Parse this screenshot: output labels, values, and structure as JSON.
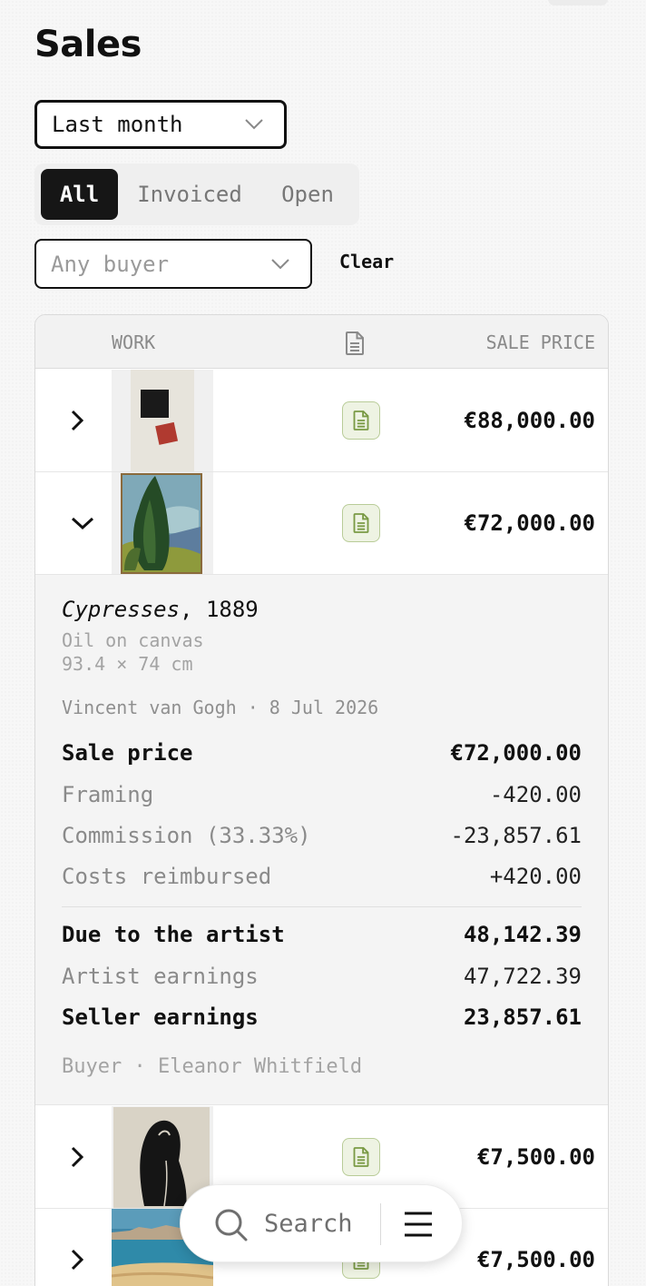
{
  "page": {
    "title": "Sales"
  },
  "filters": {
    "period": {
      "value": "Last month"
    },
    "segments": [
      {
        "label": "All",
        "selected": true
      },
      {
        "label": "Invoiced",
        "selected": false
      },
      {
        "label": "Open",
        "selected": false
      }
    ],
    "buyer": {
      "placeholder": "Any buyer"
    },
    "clear_label": "Clear"
  },
  "table": {
    "columns": {
      "work": "WORK",
      "document": "document-icon",
      "price": "SALE PRICE"
    },
    "rows": [
      {
        "expanded": false,
        "artwork_icon": "abstract-squares-thumbnail",
        "price": "€88,000.00"
      },
      {
        "expanded": true,
        "artwork_icon": "cypresses-painting-thumbnail",
        "price": "€72,000.00"
      },
      {
        "expanded": false,
        "artwork_icon": "kiss-woodcut-thumbnail",
        "price": "€7,500.00"
      },
      {
        "expanded": false,
        "artwork_icon": "seaside-painting-thumbnail",
        "price": "€7,500.00"
      }
    ],
    "detail": {
      "title_italic": "Cypresses",
      "title_rest": ", 1889",
      "medium": "Oil on canvas",
      "dimensions": "93.4 × 74 cm",
      "meta": "Vincent van Gogh · 8 Jul 2026",
      "lines": [
        {
          "label": "Sale price",
          "value": "€72,000.00"
        },
        {
          "label": "Framing",
          "value": "-420.00"
        },
        {
          "label": "Commission (33.33%)",
          "value": "-23,857.61"
        },
        {
          "label": "Costs reimbursed",
          "value": "+420.00"
        },
        {
          "label": "Due to the artist",
          "value": "48,142.39"
        },
        {
          "label": "Artist earnings",
          "value": "47,722.39"
        },
        {
          "label": "Seller earnings",
          "value": "23,857.61"
        }
      ],
      "buyer": "Buyer · Eleanor Whitfield"
    }
  },
  "bottom_bar": {
    "search_label": "Search",
    "search_icon": "search-icon",
    "menu_icon": "menu-icon"
  },
  "colors": {
    "accent_dark": "#161616",
    "doc_badge_bg": "#eef3e3",
    "doc_badge_border": "#b9cc98",
    "doc_icon": "#7a9a45"
  }
}
